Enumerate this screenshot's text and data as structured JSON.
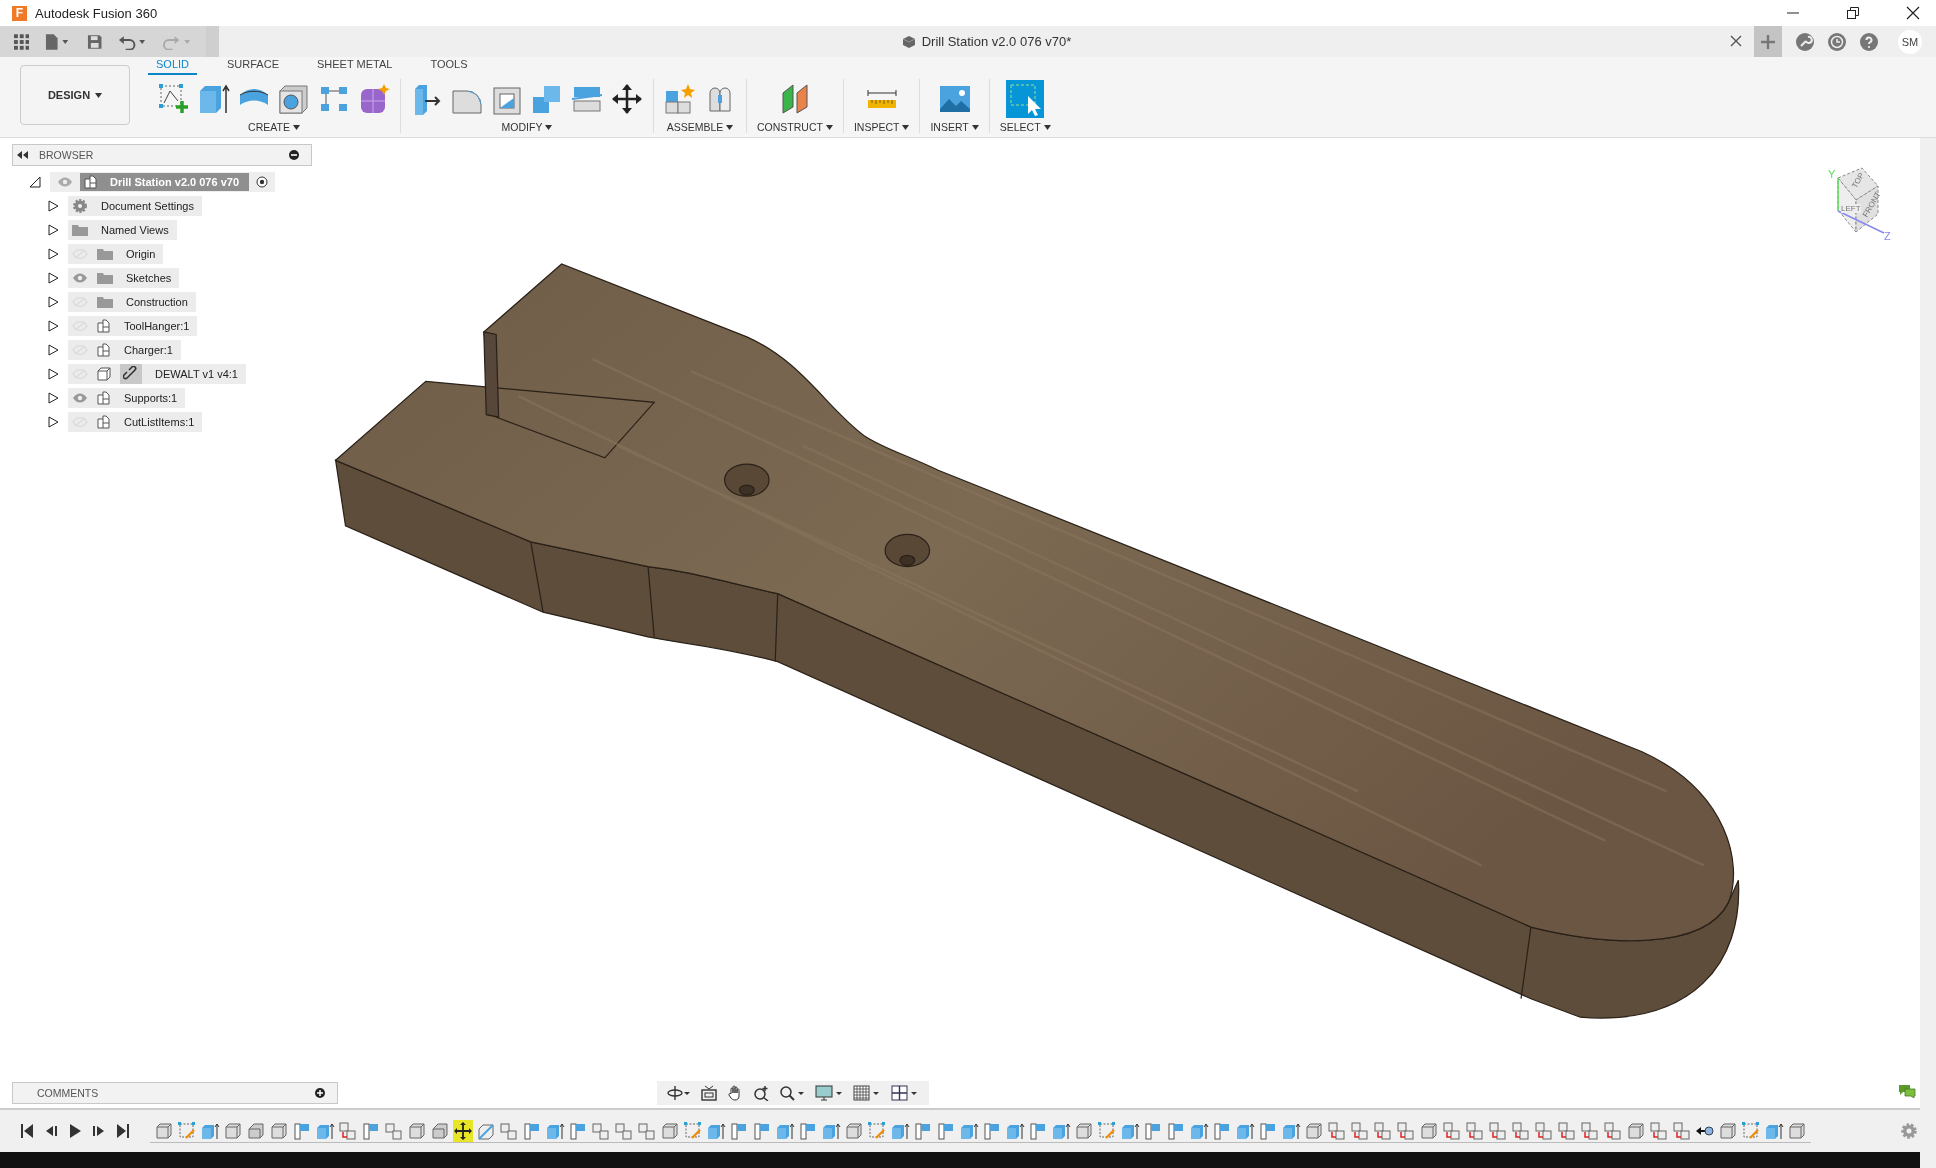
{
  "app": {
    "logo_letter": "F",
    "title": "Autodesk Fusion 360"
  },
  "document_tab": {
    "title": "Drill Station v2.0 076 v70*"
  },
  "user": {
    "initials": "SM"
  },
  "workspace_button": {
    "label": "DESIGN"
  },
  "toolbar_tabs": [
    {
      "label": "SOLID",
      "selected": true
    },
    {
      "label": "SURFACE",
      "selected": false
    },
    {
      "label": "SHEET METAL",
      "selected": false
    },
    {
      "label": "TOOLS",
      "selected": false
    }
  ],
  "tool_groups": [
    {
      "label": "CREATE",
      "tools": [
        {
          "kind": "sketch"
        },
        {
          "kind": "extrude"
        },
        {
          "kind": "revolve"
        },
        {
          "kind": "hole"
        },
        {
          "kind": "pattern"
        },
        {
          "kind": "form"
        }
      ]
    },
    {
      "label": "MODIFY",
      "tools": [
        {
          "kind": "presspull"
        },
        {
          "kind": "fillet"
        },
        {
          "kind": "shell"
        },
        {
          "kind": "combine"
        },
        {
          "kind": "splitface"
        },
        {
          "kind": "move"
        }
      ]
    },
    {
      "label": "ASSEMBLE",
      "tools": [
        {
          "kind": "component"
        },
        {
          "kind": "joint"
        }
      ]
    },
    {
      "label": "CONSTRUCT",
      "tools": [
        {
          "kind": "plane"
        }
      ]
    },
    {
      "label": "INSPECT",
      "tools": [
        {
          "kind": "measure"
        }
      ]
    },
    {
      "label": "INSERT",
      "tools": [
        {
          "kind": "image"
        }
      ]
    },
    {
      "label": "SELECT",
      "tools": [
        {
          "kind": "select"
        }
      ]
    }
  ],
  "browser": {
    "title": "BROWSER",
    "root": {
      "label": "Drill Station v2.0 076 v70",
      "expanded": true,
      "visible": true,
      "active": true,
      "children": [
        {
          "label": "Document Settings",
          "kind": "settings",
          "expanded": false
        },
        {
          "label": "Named Views",
          "kind": "folder",
          "expanded": false
        },
        {
          "label": "Origin",
          "kind": "folder",
          "expanded": false,
          "visible": false
        },
        {
          "label": "Sketches",
          "kind": "folder",
          "expanded": false,
          "visible": true
        },
        {
          "label": "Construction",
          "kind": "folder",
          "expanded": false,
          "visible": false
        },
        {
          "label": "ToolHanger:1",
          "kind": "component",
          "expanded": false,
          "visible": false
        },
        {
          "label": "Charger:1",
          "kind": "component",
          "expanded": false,
          "visible": false
        },
        {
          "label": "DEWALT v1 v4:1",
          "kind": "linked",
          "expanded": false,
          "visible": false
        },
        {
          "label": "Supports:1",
          "kind": "component",
          "expanded": false,
          "visible": true
        },
        {
          "label": "CutListItems:1",
          "kind": "component",
          "expanded": false,
          "visible": false
        }
      ]
    }
  },
  "viewcube": {
    "top": "TOP",
    "left": "LEFT",
    "front": "FRONT",
    "y_axis": "Y",
    "z_axis": "Z"
  },
  "comments": {
    "title": "COMMENTS"
  },
  "timeline": {
    "features": [
      {
        "kind": "box",
        "selected": false
      },
      {
        "kind": "sketch",
        "selected": false
      },
      {
        "kind": "extrude",
        "selected": false
      },
      {
        "kind": "box",
        "selected": false
      },
      {
        "kind": "chamfer",
        "selected": false
      },
      {
        "kind": "box",
        "selected": false
      },
      {
        "kind": "plane",
        "selected": false
      },
      {
        "kind": "extrude",
        "selected": false
      },
      {
        "kind": "copy",
        "selected": false
      },
      {
        "kind": "plane",
        "selected": false
      },
      {
        "kind": "combine",
        "selected": false
      },
      {
        "kind": "box",
        "selected": false
      },
      {
        "kind": "chamfer",
        "selected": false
      },
      {
        "kind": "move",
        "selected": true
      },
      {
        "kind": "split",
        "selected": false
      },
      {
        "kind": "combine",
        "selected": false
      },
      {
        "kind": "plane",
        "selected": false
      },
      {
        "kind": "extrude",
        "selected": false
      },
      {
        "kind": "plane",
        "selected": false
      },
      {
        "kind": "combine",
        "selected": false
      },
      {
        "kind": "combine",
        "selected": false
      },
      {
        "kind": "combine",
        "selected": false
      },
      {
        "kind": "box",
        "selected": false
      },
      {
        "kind": "sketch",
        "selected": false
      },
      {
        "kind": "extrude",
        "selected": false
      },
      {
        "kind": "plane",
        "selected": false
      },
      {
        "kind": "plane",
        "selected": false
      },
      {
        "kind": "extrude",
        "selected": false
      },
      {
        "kind": "plane",
        "selected": false
      },
      {
        "kind": "extrude",
        "selected": false
      },
      {
        "kind": "box",
        "selected": false
      },
      {
        "kind": "sketch",
        "selected": false
      },
      {
        "kind": "extrude",
        "selected": false
      },
      {
        "kind": "plane",
        "selected": false
      },
      {
        "kind": "plane",
        "selected": false
      },
      {
        "kind": "extrude",
        "selected": false
      },
      {
        "kind": "plane",
        "selected": false
      },
      {
        "kind": "extrude",
        "selected": false
      },
      {
        "kind": "plane",
        "selected": false
      },
      {
        "kind": "extrude",
        "selected": false
      },
      {
        "kind": "box",
        "selected": false
      },
      {
        "kind": "sketch",
        "selected": false
      },
      {
        "kind": "extrude",
        "selected": false
      },
      {
        "kind": "plane",
        "selected": false
      },
      {
        "kind": "plane",
        "selected": false
      },
      {
        "kind": "extrude",
        "selected": false
      },
      {
        "kind": "plane",
        "selected": false
      },
      {
        "kind": "extrude",
        "selected": false
      },
      {
        "kind": "plane",
        "selected": false
      },
      {
        "kind": "extrude",
        "selected": false
      },
      {
        "kind": "box",
        "selected": false
      },
      {
        "kind": "copy",
        "selected": false
      },
      {
        "kind": "copy",
        "selected": false
      },
      {
        "kind": "copy",
        "selected": false
      },
      {
        "kind": "copy",
        "selected": false
      },
      {
        "kind": "box",
        "selected": false
      },
      {
        "kind": "copy",
        "selected": false
      },
      {
        "kind": "copy",
        "selected": false
      },
      {
        "kind": "copy",
        "selected": false
      },
      {
        "kind": "copy",
        "selected": false
      },
      {
        "kind": "copy",
        "selected": false
      },
      {
        "kind": "copy",
        "selected": false
      },
      {
        "kind": "copy",
        "selected": false
      },
      {
        "kind": "copy",
        "selected": false
      },
      {
        "kind": "box",
        "selected": false
      },
      {
        "kind": "copy",
        "selected": false
      },
      {
        "kind": "copy",
        "selected": false
      },
      {
        "kind": "marker",
        "selected": false
      },
      {
        "kind": "box",
        "selected": false
      },
      {
        "kind": "sketch",
        "selected": false
      },
      {
        "kind": "extrude",
        "selected": false
      },
      {
        "kind": "box",
        "selected": false
      }
    ]
  }
}
